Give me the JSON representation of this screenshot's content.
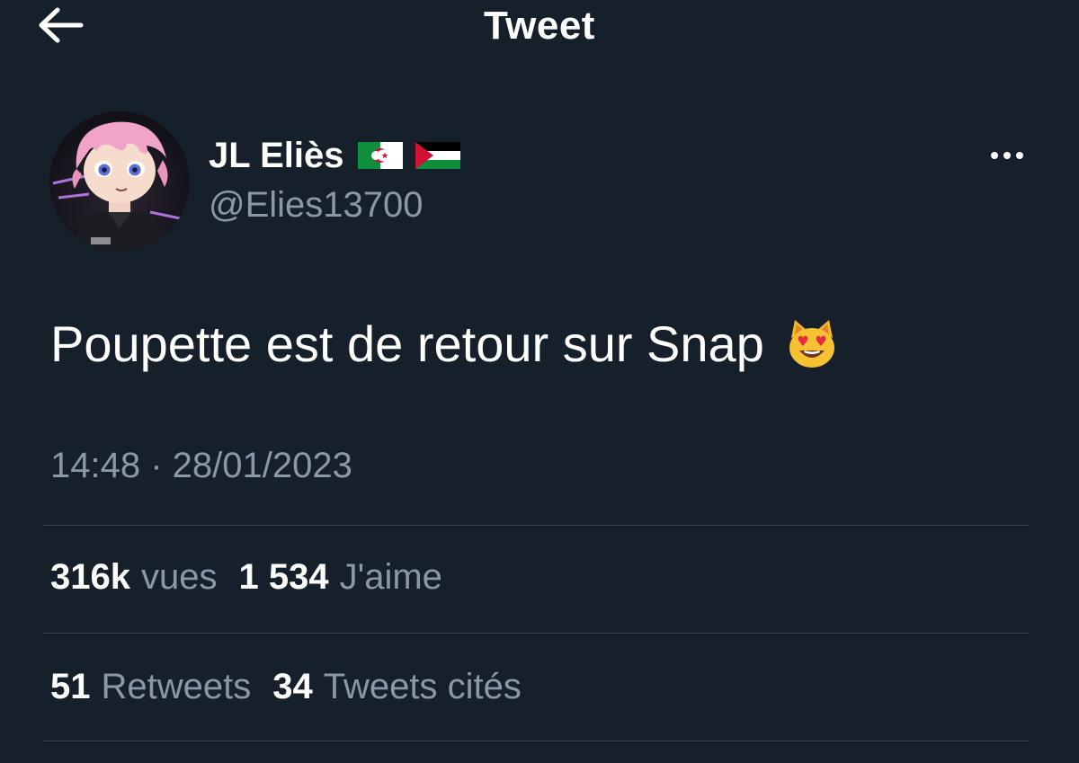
{
  "header": {
    "title": "Tweet",
    "back_icon": "arrow-left-icon"
  },
  "author": {
    "display_name": "JL Eliès",
    "flags": [
      "algeria-flag",
      "palestine-flag"
    ],
    "handle": "@Elies13700",
    "more_icon": "ellipsis-icon"
  },
  "tweet": {
    "text": "Poupette est de retour sur Snap",
    "emoji": "smiling-cat-heart-eyes-emoji",
    "timestamp": "14:48 · 28/01/2023"
  },
  "stats": {
    "views_count": "316k",
    "views_label": "vues",
    "likes_count": "1 534",
    "likes_label": "J'aime",
    "retweets_count": "51",
    "retweets_label": "Retweets",
    "quotes_count": "34",
    "quotes_label": "Tweets cités"
  },
  "colors": {
    "background": "#15202b",
    "secondary_text": "#8b98a5",
    "divider": "#38444d"
  }
}
